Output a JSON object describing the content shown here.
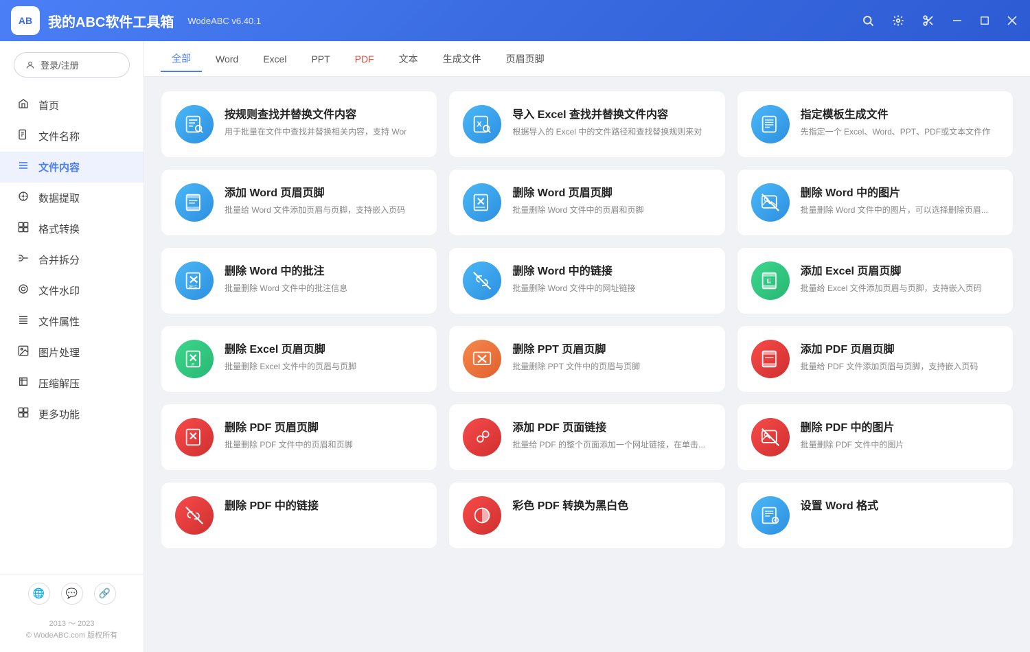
{
  "titlebar": {
    "logo": "AB",
    "title": "我的ABC软件工具箱",
    "version": "WodeABC v6.40.1",
    "search_label": "搜索",
    "settings_label": "设置",
    "scissors_label": "剪切",
    "minimize_label": "最小化",
    "maximize_label": "最大化",
    "close_label": "关闭"
  },
  "sidebar": {
    "login_label": "登录/注册",
    "nav_items": [
      {
        "id": "home",
        "icon": "⌂",
        "label": "首页"
      },
      {
        "id": "filename",
        "icon": "📄",
        "label": "文件名称"
      },
      {
        "id": "filecontent",
        "icon": "≡",
        "label": "文件内容",
        "active": true
      },
      {
        "id": "dataextract",
        "icon": "⇄",
        "label": "数据提取"
      },
      {
        "id": "formatconvert",
        "icon": "⊞",
        "label": "格式转换"
      },
      {
        "id": "mergesplit",
        "icon": "#",
        "label": "合并拆分"
      },
      {
        "id": "watermark",
        "icon": "◎",
        "label": "文件水印"
      },
      {
        "id": "fileprops",
        "icon": "≡",
        "label": "文件属性"
      },
      {
        "id": "imgprocess",
        "icon": "⊡",
        "label": "图片处理"
      },
      {
        "id": "compress",
        "icon": "⋮⋮",
        "label": "压缩解压"
      },
      {
        "id": "more",
        "icon": "⊞",
        "label": "更多功能"
      }
    ],
    "bottom_icons": [
      "🌐",
      "💬",
      "🔗"
    ],
    "copyright_line1": "2013 ～ 2023",
    "copyright_line2": "© WodeABC.com 版权所有"
  },
  "tabs": {
    "items": [
      {
        "id": "all",
        "label": "全部",
        "active": true,
        "color": "normal"
      },
      {
        "id": "word",
        "label": "Word",
        "active": false,
        "color": "normal"
      },
      {
        "id": "excel",
        "label": "Excel",
        "active": false,
        "color": "normal"
      },
      {
        "id": "ppt",
        "label": "PPT",
        "active": false,
        "color": "normal"
      },
      {
        "id": "pdf",
        "label": "PDF",
        "active": false,
        "color": "red"
      },
      {
        "id": "text",
        "label": "文本",
        "active": false,
        "color": "normal"
      },
      {
        "id": "genfile",
        "label": "生成文件",
        "active": false,
        "color": "normal"
      },
      {
        "id": "headerfoot",
        "label": "页眉页脚",
        "active": false,
        "color": "normal"
      }
    ]
  },
  "cards": [
    {
      "id": "card1",
      "icon_type": "blue",
      "icon": "📋",
      "title": "按规则查找并替换文件内容",
      "desc": "用于批量在文件中查找并替换相关内容，支持 Wor"
    },
    {
      "id": "card2",
      "icon_type": "blue",
      "icon": "📊",
      "title": "导入 Excel 查找并替换文件内容",
      "desc": "根据导入的 Excel 中的文件路径和查找替换规则来对"
    },
    {
      "id": "card3",
      "icon_type": "blue",
      "icon": "📋",
      "title": "指定模板生成文件",
      "desc": "先指定一个 Excel、Word、PPT、PDF或文本文件作"
    },
    {
      "id": "card4",
      "icon_type": "blue",
      "icon": "🖥",
      "title": "添加 Word 页眉页脚",
      "desc": "批量给 Word 文件添加页眉与页脚，支持嵌入页码"
    },
    {
      "id": "card5",
      "icon_type": "blue",
      "icon": "✖",
      "title": "删除 Word 页眉页脚",
      "desc": "批量删除 Word 文件中的页眉和页脚"
    },
    {
      "id": "card6",
      "icon_type": "blue",
      "icon": "🖼",
      "title": "删除 Word 中的图片",
      "desc": "批量删除 Word 文件中的图片，可以选择删除页眉..."
    },
    {
      "id": "card7",
      "icon_type": "blue",
      "icon": "💬",
      "title": "删除 Word 中的批注",
      "desc": "批量删除 Word 文件中的批注信息"
    },
    {
      "id": "card8",
      "icon_type": "blue",
      "icon": "🔗",
      "title": "删除 Word 中的链接",
      "desc": "批量删除 Word 文件中的网址链接"
    },
    {
      "id": "card9",
      "icon_type": "green",
      "icon": "🖥",
      "title": "添加 Excel 页眉页脚",
      "desc": "批量给 Excel 文件添加页眉与页脚，支持嵌入页码"
    },
    {
      "id": "card10",
      "icon_type": "green",
      "icon": "✖",
      "title": "删除 Excel 页眉页脚",
      "desc": "批量删除 Excel 文件中的页眉与页脚"
    },
    {
      "id": "card11",
      "icon_type": "orange",
      "icon": "✖",
      "title": "删除 PPT 页眉页脚",
      "desc": "批量删除 PPT 文件中的页眉与页脚"
    },
    {
      "id": "card12",
      "icon_type": "red",
      "icon": "🖥",
      "title": "添加 PDF 页眉页脚",
      "desc": "批量给 PDF 文件添加页眉与页脚，支持嵌入页码"
    },
    {
      "id": "card13",
      "icon_type": "red",
      "icon": "✖",
      "title": "删除 PDF 页眉页脚",
      "desc": "批量删除 PDF 文件中的页眉和页脚"
    },
    {
      "id": "card14",
      "icon_type": "red",
      "icon": "🔗",
      "title": "添加 PDF 页面链接",
      "desc": "批量给 PDF 的整个页面添加一个网址链接，在单击..."
    },
    {
      "id": "card15",
      "icon_type": "red",
      "icon": "🖼",
      "title": "删除 PDF 中的图片",
      "desc": "批量删除 PDF 文件中的图片"
    },
    {
      "id": "card16",
      "icon_type": "red",
      "icon": "🔗",
      "title": "删除 PDF 中的链接",
      "desc": ""
    },
    {
      "id": "card17",
      "icon_type": "red",
      "icon": "🎨",
      "title": "彩色 PDF 转换为黑白色",
      "desc": ""
    },
    {
      "id": "card18",
      "icon_type": "blue",
      "icon": "⚙",
      "title": "设置 Word 格式",
      "desc": ""
    }
  ]
}
